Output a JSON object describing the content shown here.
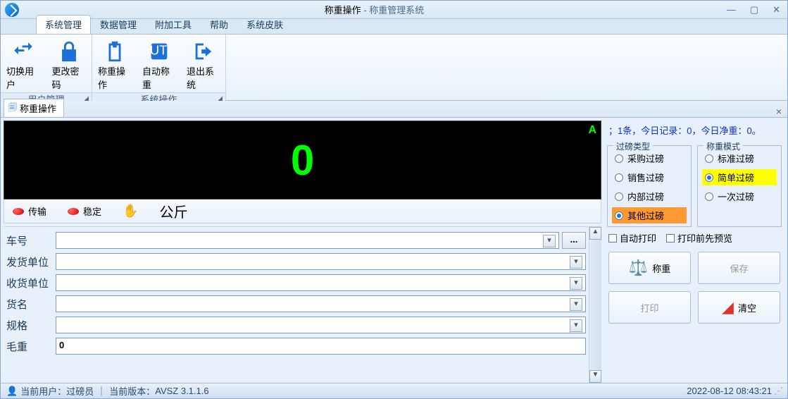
{
  "title": {
    "doc": "称重操作",
    "app": "称重管理系统"
  },
  "menus": [
    "系统管理",
    "数据管理",
    "附加工具",
    "帮助",
    "系统皮肤"
  ],
  "ribbon": {
    "group1": {
      "label": "用户管理",
      "items": [
        "切换用户",
        "更改密码"
      ]
    },
    "group2": {
      "label": "系统操作",
      "items": [
        "称重操作",
        "自动称重",
        "退出系统"
      ]
    }
  },
  "doctab": "称重操作",
  "display": {
    "value": "0",
    "corner": "A"
  },
  "status": {
    "transmit": "传输",
    "stable": "稳定",
    "unit": "公斤"
  },
  "form": {
    "labels": {
      "car": "车号",
      "sender": "发货单位",
      "receiver": "收货单位",
      "goods": "货名",
      "spec": "规格",
      "gross": "毛重"
    },
    "gross_value": "0",
    "ellipsis": "..."
  },
  "info_line": "；1条，今日记录：0，今日净重：0。",
  "type_group": {
    "legend": "过磅类型",
    "options": [
      "采购过磅",
      "销售过磅",
      "内部过磅",
      "其他过磅"
    ],
    "selected": 3
  },
  "mode_group": {
    "legend": "称重模式",
    "options": [
      "标准过磅",
      "简单过磅",
      "一次过磅"
    ],
    "selected": 1
  },
  "checks": {
    "autoprint": "自动打印",
    "preview": "打印前先预览"
  },
  "buttons": {
    "weigh": "称重",
    "save": "保存",
    "print": "打印",
    "clear": "清空"
  },
  "footer": {
    "user_label": "当前用户：",
    "user": "过磅员",
    "ver_label": "当前版本：",
    "ver": "AVSZ 3.1.1.6",
    "datetime": "2022-08-12 08:43:21"
  }
}
